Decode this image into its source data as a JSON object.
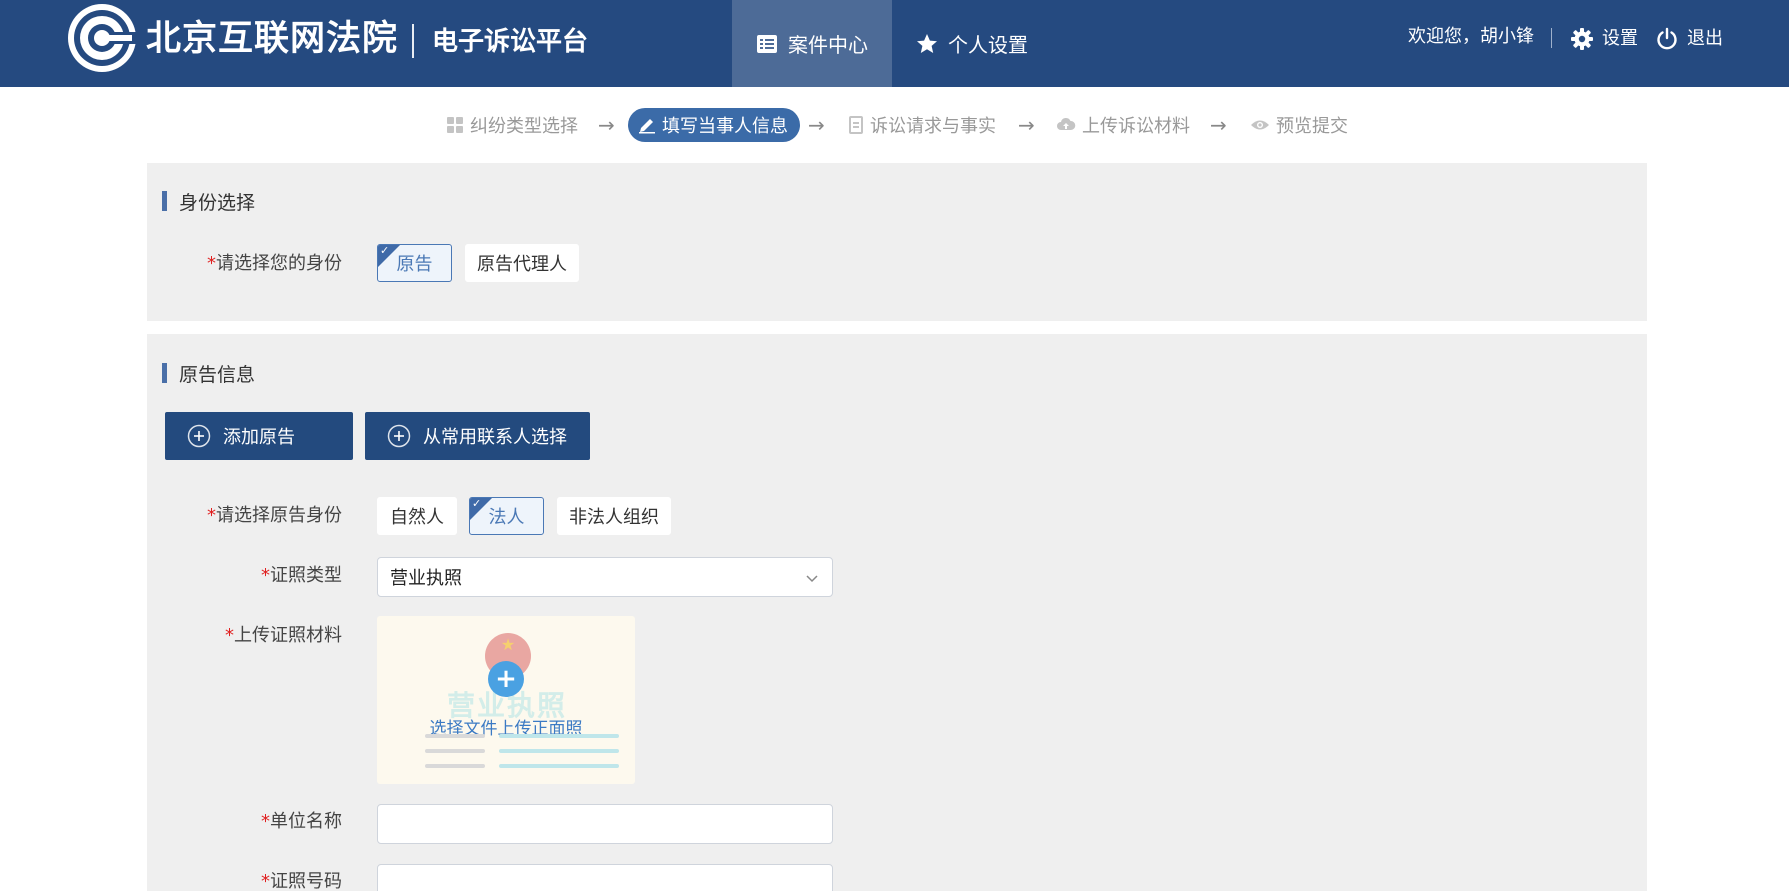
{
  "colors": {
    "header_bg": "#254a80",
    "active_nav_bg": "#4d6b97",
    "step_active_bg": "#3b6ba8",
    "primary_button_bg": "#234a7e",
    "panel_bg": "#efefef",
    "required_mark": "#e02020",
    "selected_border": "#4a78b5"
  },
  "header": {
    "court_name": "北京互联网法院",
    "platform_name": "电子诉讼平台",
    "nav": [
      {
        "label": "案件中心",
        "icon": "list-icon",
        "active": true
      },
      {
        "label": "个人设置",
        "icon": "star-icon",
        "active": false
      }
    ],
    "welcome": "欢迎您，胡小锋",
    "settings_label": "设置",
    "logout_label": "退出"
  },
  "steps": [
    {
      "label": "纠纷类型选择",
      "icon": "grid-icon",
      "active": false
    },
    {
      "label": "填写当事人信息",
      "icon": "pencil-icon",
      "active": true
    },
    {
      "label": "诉讼请求与事实",
      "icon": "document-icon",
      "active": false
    },
    {
      "label": "上传诉讼材料",
      "icon": "cloud-upload-icon",
      "active": false
    },
    {
      "label": "预览提交",
      "icon": "eye-icon",
      "active": false
    }
  ],
  "identity_section": {
    "title": "身份选择",
    "label_required": "*",
    "label": "请选择您的身份",
    "options": [
      {
        "label": "原告",
        "selected": true
      },
      {
        "label": "原告代理人",
        "selected": false
      }
    ]
  },
  "plaintiff_section": {
    "title": "原告信息",
    "add_button": "添加原告",
    "contacts_button": "从常用联系人选择",
    "type_label": "请选择原告身份",
    "type_options": [
      {
        "label": "自然人",
        "selected": false
      },
      {
        "label": "法人",
        "selected": true
      },
      {
        "label": "非法人组织",
        "selected": false
      }
    ],
    "cert_type_label": "证照类型",
    "cert_type_value": "营业执照",
    "upload_label": "上传证照材料",
    "upload_text": "选择文件上传正面照",
    "upload_watermark": "营业执照",
    "org_name_label": "单位名称",
    "org_name_value": "",
    "cert_number_label": "证照号码",
    "cert_number_value": "",
    "required_mark": "*"
  }
}
